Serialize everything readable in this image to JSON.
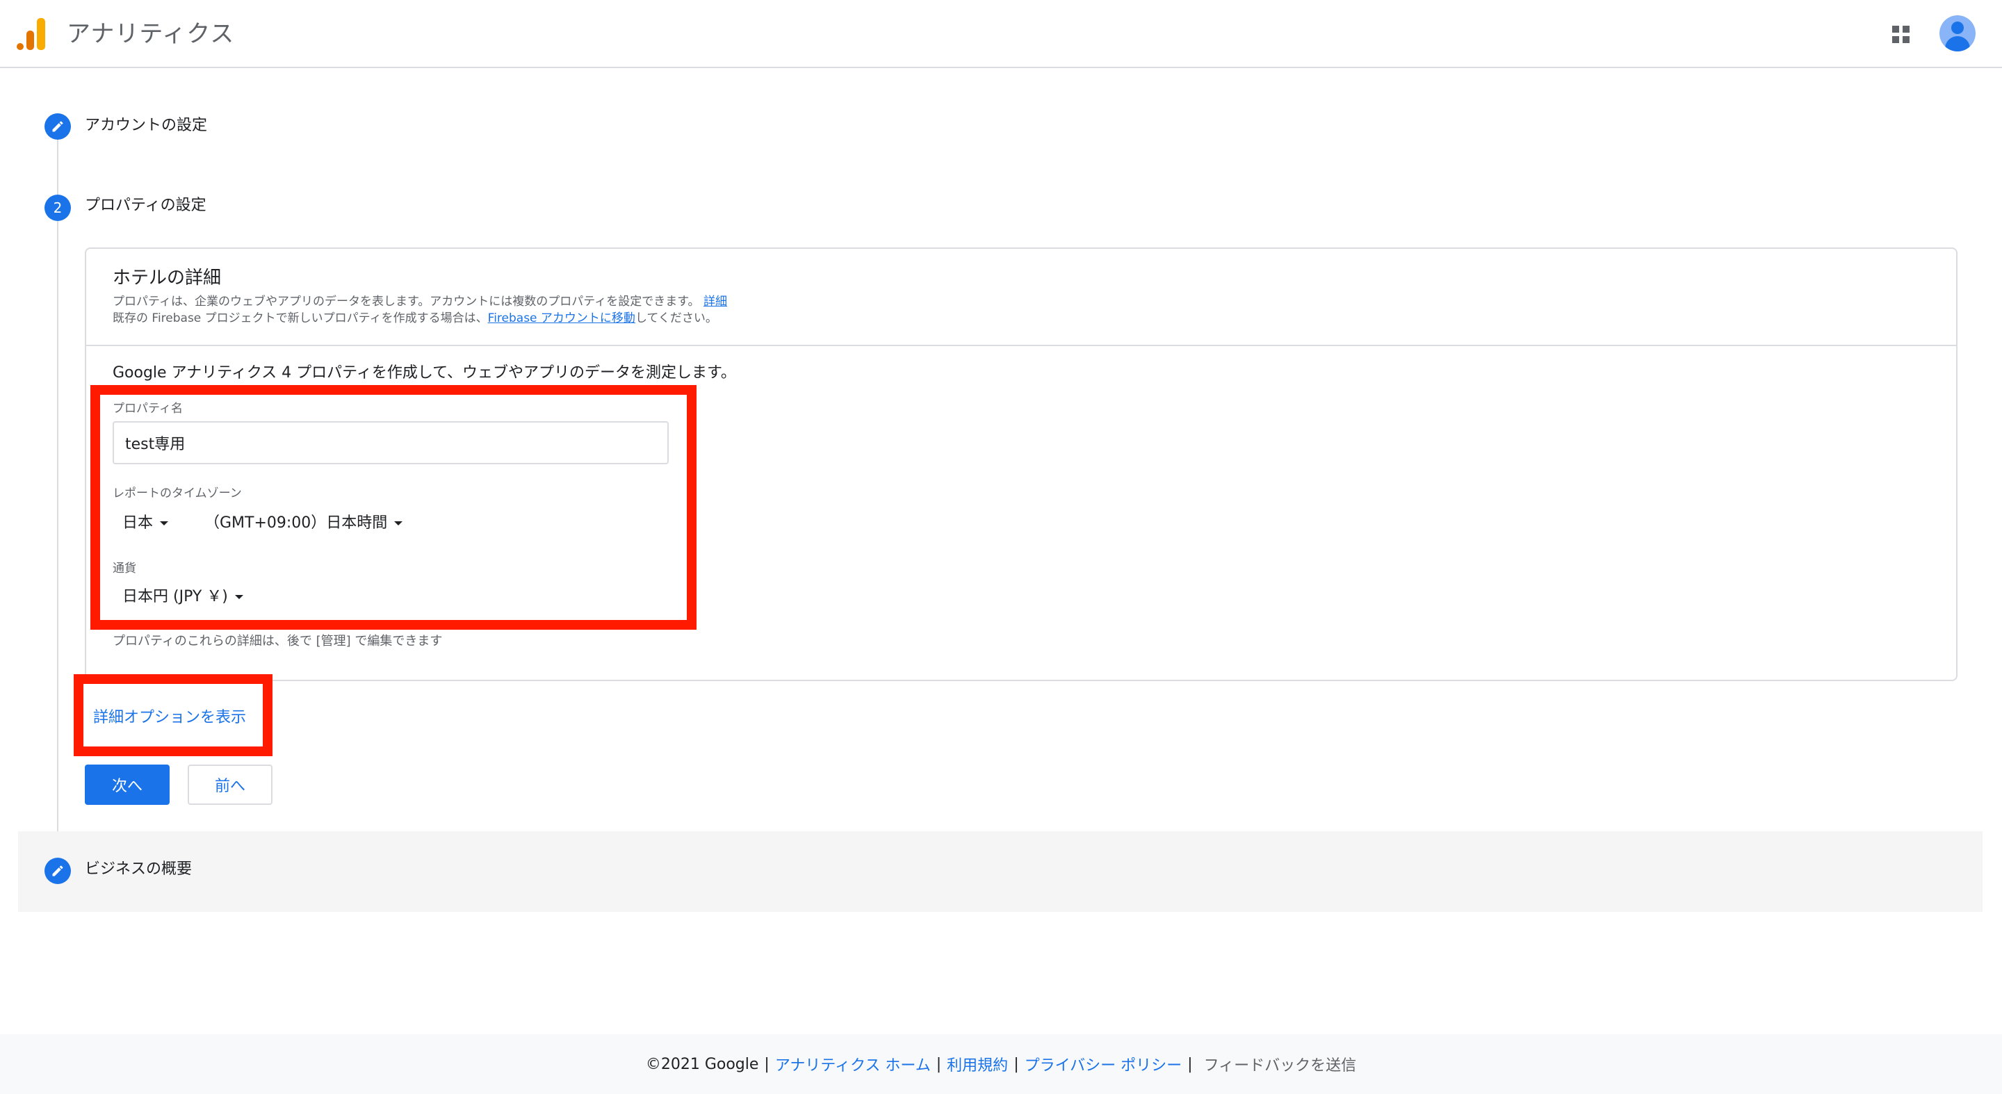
{
  "header": {
    "app_title": "アナリティクス"
  },
  "steps": [
    {
      "label": "アカウントの設定",
      "state": "edit-icon"
    },
    {
      "label": "プロパティの設定",
      "number": "2"
    },
    {
      "label": "ビジネスの概要",
      "state": "edit-icon"
    }
  ],
  "card": {
    "title": "ホテルの詳細",
    "desc_line1": "プロパティは、企業のウェブやアプリのデータを表します。アカウントには複数のプロパティを設定できます。",
    "desc_line1_link": "詳細",
    "desc_line2_prefix": "既存の Firebase プロジェクトで新しいプロパティを作成する場合は、",
    "desc_line2_link": "Firebase アカウントに移動",
    "desc_line2_suffix": "してください。",
    "intro": "Google アナリティクス 4 プロパティを作成して、ウェブやアプリのデータを測定します。",
    "property_name_label": "プロパティ名",
    "property_name_value": "test専用",
    "timezone_label": "レポートのタイムゾーン",
    "timezone_country": "日本",
    "timezone_value": "（GMT+09:00）日本時間",
    "currency_label": "通貨",
    "currency_value": "日本円 (JPY ￥)",
    "footnote": "プロパティのこれらの詳細は、後で [管理] で編集できます"
  },
  "advanced_link": "詳細オプションを表示",
  "buttons": {
    "next": "次へ",
    "back": "前へ"
  },
  "footer": {
    "copyright": "©2021 Google",
    "links": [
      "アナリティクス ホーム",
      "利用規約",
      "プライバシー ポリシー"
    ],
    "feedback": "フィードバックを送信"
  },
  "colors": {
    "primary": "#1a73e8",
    "highlight": "#ff1a00",
    "logo_orange": "#e37400",
    "logo_yellow": "#f9ab00"
  }
}
